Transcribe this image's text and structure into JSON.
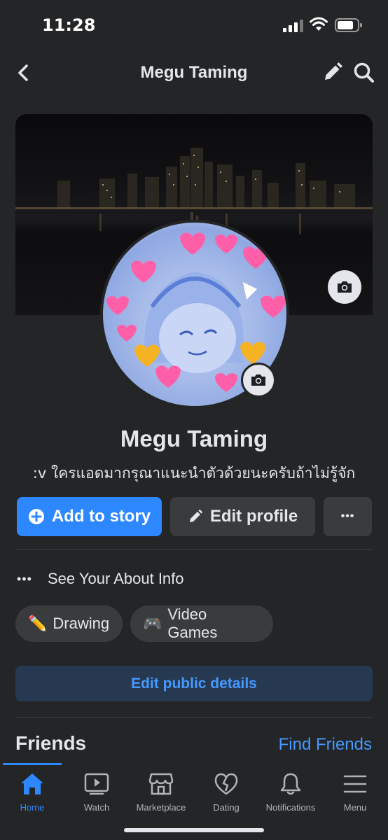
{
  "status_bar": {
    "time": "11:28"
  },
  "nav": {
    "title": "Megu Taming"
  },
  "profile": {
    "name": "Megu Taming",
    "bio": ":v ใครแอดมากรุณาแนะนำตัวด้วยนะครับถ้าไม่รู้จัก"
  },
  "actions": {
    "add_story": "Add to story",
    "edit_profile": "Edit profile",
    "more": "•••"
  },
  "about": {
    "dots": "•••",
    "label": "See Your About Info"
  },
  "interests": [
    {
      "emoji": "✏️",
      "label": "Drawing"
    },
    {
      "emoji": "🎮",
      "label": "Video Games"
    }
  ],
  "edit_public": "Edit public details",
  "friends": {
    "title": "Friends",
    "find": "Find Friends"
  },
  "tabs": [
    {
      "label": "Home",
      "icon": "home-icon",
      "active": true
    },
    {
      "label": "Watch",
      "icon": "watch-icon"
    },
    {
      "label": "Marketplace",
      "icon": "marketplace-icon"
    },
    {
      "label": "Dating",
      "icon": "dating-icon"
    },
    {
      "label": "Notifications",
      "icon": "bell-icon"
    },
    {
      "label": "Menu",
      "icon": "menu-icon"
    }
  ],
  "colors": {
    "accent": "#2d88ff",
    "background": "#242526",
    "button": "#3a3b3c",
    "link": "#4599ff"
  }
}
